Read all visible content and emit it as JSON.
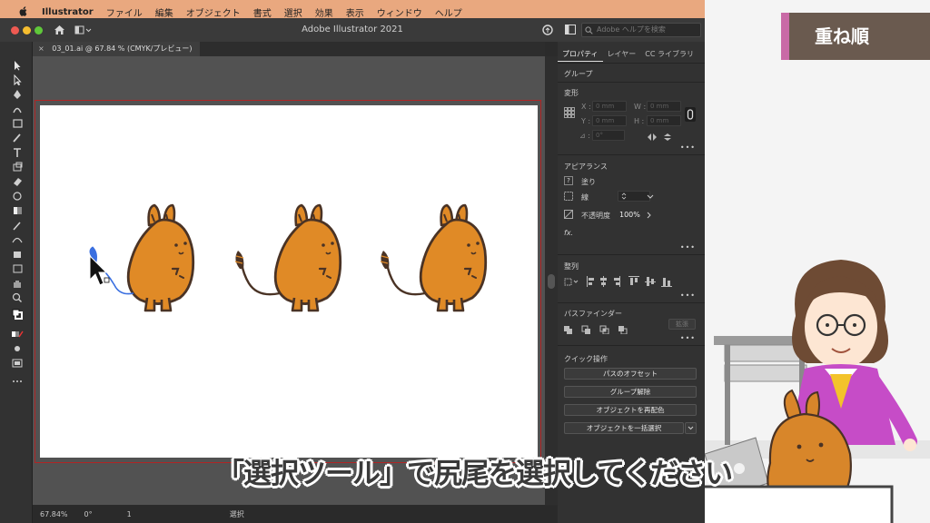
{
  "menubar": {
    "app_name": "Illustrator",
    "items": [
      "ファイル",
      "編集",
      "オブジェクト",
      "書式",
      "選択",
      "効果",
      "表示",
      "ウィンドウ",
      "ヘルプ"
    ]
  },
  "window": {
    "title": "Adobe Illustrator 2021",
    "search_placeholder": "Adobe ヘルプを検索"
  },
  "document_tab": {
    "label": "03_01.ai @ 67.84 % (CMYK/プレビュー)"
  },
  "status_bar": {
    "zoom": "67.84%",
    "rotation": "0°",
    "artboard_number": "1",
    "tool_name": "選択"
  },
  "panel": {
    "tabs": [
      "プロパティ",
      "レイヤー",
      "CC ライブラリ"
    ],
    "selection_type": "グループ",
    "transform": {
      "title": "変形",
      "x_label": "X :",
      "y_label": "Y :",
      "w_label": "W :",
      "h_label": "H :",
      "x_value": "0 mm",
      "y_value": "0 mm",
      "w_value": "0 mm",
      "h_value": "0 mm",
      "angle_label": "⊿ :",
      "angle_value": "0°"
    },
    "appearance": {
      "title": "アピアランス",
      "fill_label": "塗り",
      "stroke_label": "線",
      "opacity_label": "不透明度",
      "opacity_value": "100%",
      "fx_label": "fx."
    },
    "align": {
      "title": "整列"
    },
    "pathfinder": {
      "title": "パスファインダー",
      "expand_label": "拡張"
    },
    "quick_actions": {
      "title": "クイック操作",
      "buttons": [
        "パスのオフセット",
        "グループ解除",
        "オブジェクトを再配色",
        "オブジェクトを一括選択"
      ]
    }
  },
  "overlay": {
    "chapter": "重ね順",
    "subtitle": "「選択ツール」で尻尾を選択してください"
  },
  "colors": {
    "menubar": "#e9a87f",
    "character_body": "#e08a26",
    "selection_blue": "#3a6fe0",
    "artboard_border": "#b02525"
  }
}
